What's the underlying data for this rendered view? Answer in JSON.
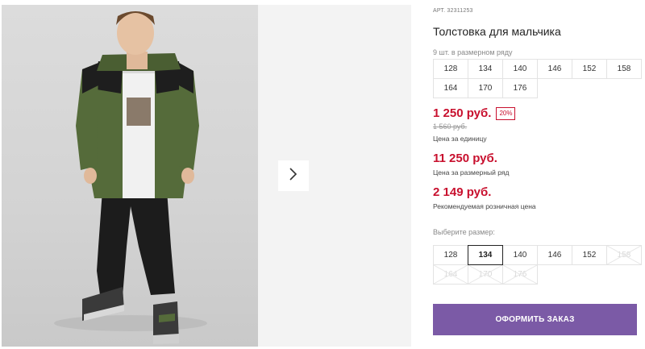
{
  "gallery": {
    "next_icon": "chevron-right-icon"
  },
  "product": {
    "article": "АРТ. 32311253",
    "title": "Толстовка для мальчика",
    "range_label": "9 шт. в размерном ряду",
    "range_sizes": [
      "128",
      "134",
      "140",
      "146",
      "152",
      "158",
      "164",
      "170",
      "176"
    ],
    "price": "1 250 руб.",
    "discount": "20%",
    "old_price": "1 560 руб.",
    "unit_caption": "Цена за единицу",
    "range_price": "11 250 руб.",
    "range_caption": "Цена за размерный ряд",
    "retail_price": "2 149 руб.",
    "retail_caption": "Рекомендуемая розничная цена",
    "choose_label": "Выберите размер:",
    "select_sizes": [
      {
        "label": "128",
        "state": "available"
      },
      {
        "label": "134",
        "state": "selected"
      },
      {
        "label": "140",
        "state": "available"
      },
      {
        "label": "146",
        "state": "available"
      },
      {
        "label": "152",
        "state": "available"
      },
      {
        "label": "158",
        "state": "disabled"
      },
      {
        "label": "164",
        "state": "disabled"
      },
      {
        "label": "170",
        "state": "disabled"
      },
      {
        "label": "176",
        "state": "disabled"
      }
    ],
    "order_button": "ОФОРМИТЬ ЗАКАЗ"
  },
  "colors": {
    "price_red": "#c8102e",
    "button_purple": "#7b5aa6"
  }
}
